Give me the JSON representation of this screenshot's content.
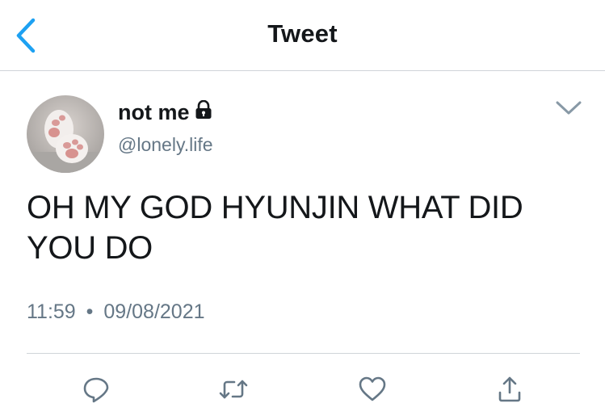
{
  "header": {
    "title": "Tweet",
    "back_icon": "chevron-left-icon",
    "accent_color": "#1da1f2"
  },
  "tweet": {
    "author": {
      "display_name": "not me",
      "handle": "@lonely.life",
      "protected_icon": "lock-icon"
    },
    "text": "OH MY GOD HYUNJIN WHAT DID YOU DO",
    "time": "11:59",
    "separator": "•",
    "date": "09/08/2021"
  },
  "actions": [
    {
      "icon": "reply-icon"
    },
    {
      "icon": "retweet-icon"
    },
    {
      "icon": "like-icon"
    },
    {
      "icon": "share-icon"
    }
  ],
  "colors": {
    "text_primary": "#14171a",
    "text_secondary": "#657786",
    "divider": "#cfd4d9",
    "icon_gray": "#657786"
  }
}
